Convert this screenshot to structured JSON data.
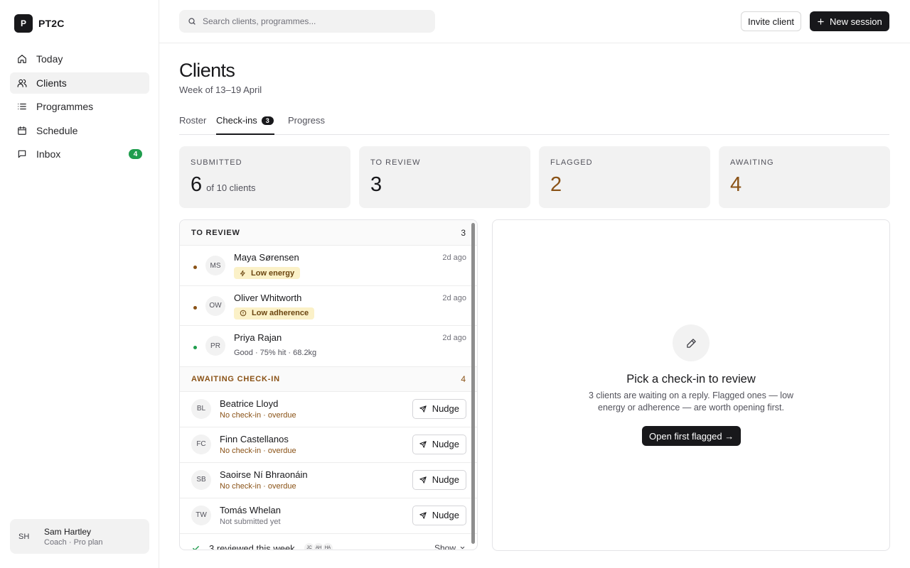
{
  "brand": {
    "mark": "P",
    "name": "PT2C"
  },
  "sidebar": {
    "items": [
      {
        "label": "Today",
        "icon": "home-icon"
      },
      {
        "label": "Clients",
        "icon": "users-icon",
        "active": true
      },
      {
        "label": "Programmes",
        "icon": "list-icon"
      },
      {
        "label": "Schedule",
        "icon": "calendar-icon"
      },
      {
        "label": "Inbox",
        "icon": "message-icon",
        "badge": "4"
      }
    ],
    "user": {
      "initials": "SH",
      "name": "Sam Hartley",
      "role": "Coach · Pro plan"
    }
  },
  "topbar": {
    "search_placeholder": "Search clients, programmes...",
    "invite_label": "Invite client",
    "new_session_label": "New session"
  },
  "page": {
    "title": "Clients",
    "subtitle": "Week of 13–19 April",
    "tabs": [
      {
        "label": "Roster"
      },
      {
        "label": "Check-ins",
        "count": "3",
        "active": true
      },
      {
        "label": "Progress"
      }
    ]
  },
  "stats": [
    {
      "label": "SUBMITTED",
      "value": "6",
      "suffix": "of 10 clients"
    },
    {
      "label": "TO REVIEW",
      "value": "3"
    },
    {
      "label": "FLAGGED",
      "value": "2",
      "color": "#8a5216"
    },
    {
      "label": "AWAITING",
      "value": "4",
      "color": "#8a5216"
    }
  ],
  "review": {
    "heading": "TO REVIEW",
    "count": "3",
    "rows": [
      {
        "initials": "MS",
        "name": "Maya Sørensen",
        "time": "2d ago",
        "flag": "Low energy",
        "flag_icon": "bolt-icon",
        "dot_color": "#8a5216"
      },
      {
        "initials": "OW",
        "name": "Oliver Whitworth",
        "time": "2d ago",
        "flag": "Low adherence",
        "flag_icon": "alert-circle-icon",
        "dot_color": "#8a5216"
      },
      {
        "initials": "PR",
        "name": "Priya Rajan",
        "time": "2d ago",
        "meta": "Good · 75% hit · 68.2kg",
        "dot_color": "#1f9d4d"
      }
    ]
  },
  "awaiting": {
    "heading": "AWAITING CHECK-IN",
    "count": "4",
    "nudge_label": "Nudge",
    "rows": [
      {
        "initials": "BL",
        "name": "Beatrice Lloyd",
        "status": "No check-in · overdue"
      },
      {
        "initials": "FC",
        "name": "Finn Castellanos",
        "status": "No check-in · overdue"
      },
      {
        "initials": "SB",
        "name": "Saoirse Ní Bhraonáin",
        "status": "No check-in · overdue"
      },
      {
        "initials": "TW",
        "name": "Tomás Whelan",
        "status": "Not submitted yet"
      }
    ]
  },
  "reviewed": {
    "label": "3 reviewed this week",
    "avatars": [
      "JC",
      "AH",
      "HA"
    ],
    "show_label": "Show"
  },
  "detail": {
    "title": "Pick a check-in to review",
    "body": "3 clients are waiting on a reply. Flagged ones — low energy or adherence — are worth opening first.",
    "cta": "Open first flagged →"
  }
}
